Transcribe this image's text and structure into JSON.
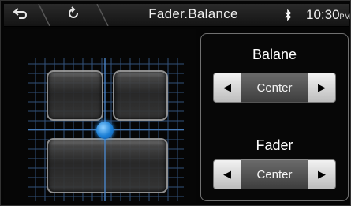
{
  "header": {
    "title": "Fader.Balance",
    "back_icon": "back-arrow-icon",
    "loop_icon": "loop-icon",
    "bluetooth_icon": "bluetooth-icon",
    "time": "10:30",
    "ampm": "PM"
  },
  "balance": {
    "label": "Balane",
    "value": "Center",
    "left_icon": "triangle-left-icon",
    "right_icon": "triangle-right-icon"
  },
  "fader": {
    "label": "Fader",
    "value": "Center",
    "left_icon": "triangle-left-icon",
    "right_icon": "triangle-right-icon"
  },
  "colors": {
    "accent": "#1b7fd6",
    "grid_line": "#3a5f8f"
  }
}
